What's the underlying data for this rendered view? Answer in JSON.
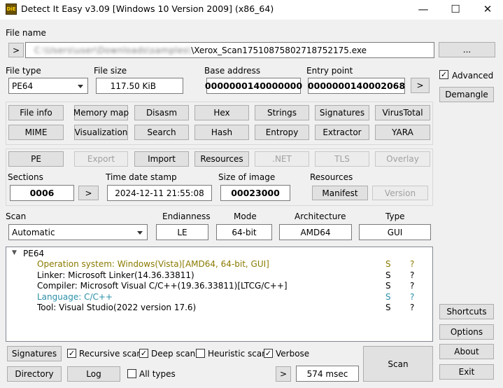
{
  "window": {
    "title": "Detect It Easy v3.09 [Windows 10 Version 2009] (x86_64)",
    "icon_text": "DiE",
    "minimize": "—",
    "maximize": "☐",
    "close": "✕"
  },
  "file": {
    "label": "File name",
    "path_hidden": "C:\\Users\\user\\Downloads\\samples\\",
    "path_visible": "\\Xerox_Scan17510875802718752175.exe",
    "nav_button": ">",
    "browse_button": "..."
  },
  "header_fields": {
    "file_type_label": "File type",
    "file_type_value": "PE64",
    "file_size_label": "File size",
    "file_size_value": "117.50 KiB",
    "base_address_label": "Base address",
    "base_address_value": "0000000140000000",
    "entry_point_label": "Entry point",
    "entry_point_value": "0000000140002068",
    "entry_nav": ">"
  },
  "right_panel": {
    "advanced_label": "Advanced",
    "advanced_checked": true,
    "demangle": "Demangle",
    "shortcuts": "Shortcuts",
    "options": "Options",
    "about": "About",
    "exit": "Exit"
  },
  "tool_buttons": {
    "row1": [
      "File info",
      "Memory map",
      "Disasm",
      "Hex",
      "Strings",
      "Signatures",
      "VirusTotal"
    ],
    "row2": [
      "MIME",
      "Visualization",
      "Search",
      "Hash",
      "Entropy",
      "Extractor",
      "YARA"
    ]
  },
  "pe_buttons": {
    "items": [
      "PE",
      "Export",
      "Import",
      "Resources",
      ".NET",
      "TLS",
      "Overlay"
    ],
    "enabled": [
      true,
      false,
      true,
      true,
      false,
      false,
      false
    ]
  },
  "pe_info": {
    "sections_label": "Sections",
    "sections_value": "0006",
    "sections_nav": ">",
    "timestamp_label": "Time date stamp",
    "timestamp_value": "2024-12-11 21:55:08",
    "image_size_label": "Size of image",
    "image_size_value": "00023000",
    "resources_label": "Resources",
    "manifest": "Manifest",
    "version": "Version"
  },
  "scan_row": {
    "scan_label": "Scan",
    "scan_mode": "Automatic",
    "endianness_label": "Endianness",
    "endianness_value": "LE",
    "mode_label": "Mode",
    "mode_value": "64-bit",
    "architecture_label": "Architecture",
    "architecture_value": "AMD64",
    "type_label": "Type",
    "type_value": "GUI"
  },
  "results": {
    "root": "PE64",
    "rows": [
      {
        "text": "Operation system: Windows(Vista)[AMD64, 64-bit, GUI]",
        "s": "S",
        "q": "?",
        "color": "#8a7a00"
      },
      {
        "text": "Linker: Microsoft Linker(14.36.33811)",
        "s": "S",
        "q": "?",
        "color": "#000000"
      },
      {
        "text": "Compiler: Microsoft Visual C/C++(19.36.33811)[LTCG/C++]",
        "s": "S",
        "q": "?",
        "color": "#000000"
      },
      {
        "text": "Language: C/C++",
        "s": "S",
        "q": "?",
        "color": "#2a8fa8"
      },
      {
        "text": "Tool: Visual Studio(2022 version 17.6)",
        "s": "S",
        "q": "?",
        "color": "#000000"
      }
    ]
  },
  "bottom": {
    "signatures": "Signatures",
    "recursive_scan": "Recursive scan",
    "recursive_checked": true,
    "deep_scan": "Deep scan",
    "deep_checked": true,
    "heuristic_scan": "Heuristic scan",
    "heuristic_checked": false,
    "verbose": "Verbose",
    "verbose_checked": true,
    "directory": "Directory",
    "log": "Log",
    "all_types": "All types",
    "all_types_checked": false,
    "nav": ">",
    "elapsed": "574 msec",
    "scan": "Scan",
    "check_mark": "✓"
  }
}
